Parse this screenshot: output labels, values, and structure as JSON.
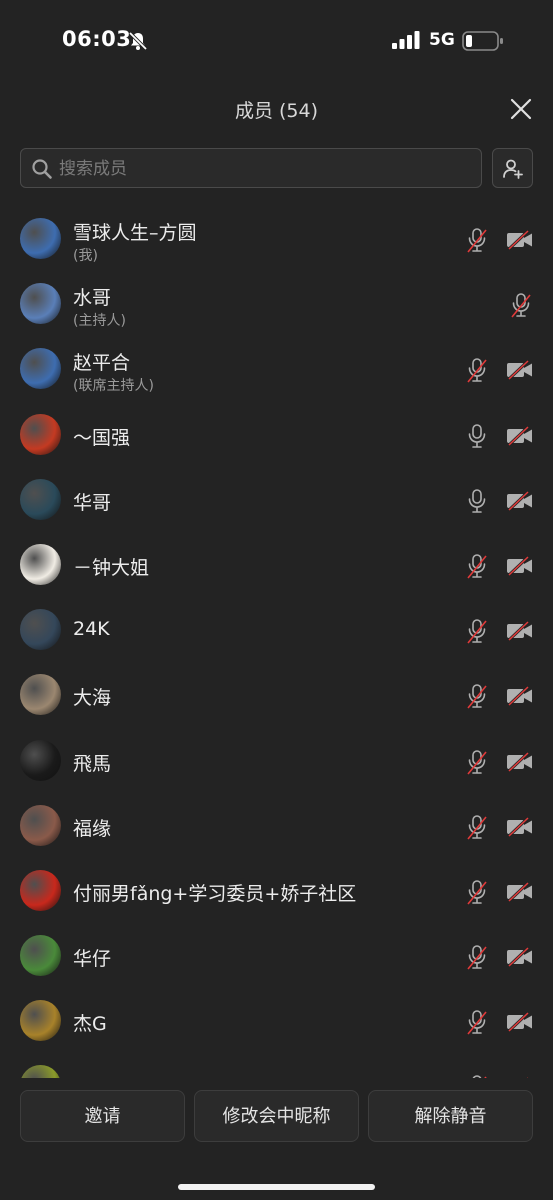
{
  "status_bar": {
    "time": "06:03",
    "network": "5G"
  },
  "header": {
    "title": "成员 (54)"
  },
  "search": {
    "placeholder": "搜索成员"
  },
  "members": [
    {
      "name": "雪球人生–方圆",
      "role": "(我)",
      "mic_muted": true,
      "video_off": true,
      "avatar_color": "#3e6db0"
    },
    {
      "name": "水哥",
      "role": "(主持人)",
      "mic_muted": true,
      "video_off": null,
      "avatar_color": "#5a7fb8"
    },
    {
      "name": "赵平合",
      "role": "(联席主持人)",
      "mic_muted": true,
      "video_off": true,
      "avatar_color": "#3e6db0"
    },
    {
      "name": "～国强",
      "role": "",
      "mic_muted": false,
      "video_off": true,
      "avatar_color": "#c43a22"
    },
    {
      "name": "华哥",
      "role": "",
      "mic_muted": false,
      "video_off": true,
      "avatar_color": "#2a4a5a"
    },
    {
      "name": "－钟大姐",
      "role": "",
      "mic_muted": true,
      "video_off": true,
      "avatar_color": "#f0ece4"
    },
    {
      "name": "24K",
      "role": "",
      "mic_muted": true,
      "video_off": true,
      "avatar_color": "#34475a"
    },
    {
      "name": "大海",
      "role": "",
      "mic_muted": true,
      "video_off": true,
      "avatar_color": "#9b8770"
    },
    {
      "name": "飛馬",
      "role": "",
      "mic_muted": true,
      "video_off": true,
      "avatar_color": "#1a1a1a"
    },
    {
      "name": "福缘",
      "role": "",
      "mic_muted": true,
      "video_off": true,
      "avatar_color": "#8a5a4a"
    },
    {
      "name": "付丽男fǎng+学习委员+娇子社区",
      "role": "",
      "mic_muted": true,
      "video_off": true,
      "avatar_color": "#c8281c"
    },
    {
      "name": "华仔",
      "role": "",
      "mic_muted": true,
      "video_off": true,
      "avatar_color": "#4a8a3a"
    },
    {
      "name": "杰G",
      "role": "",
      "mic_muted": true,
      "video_off": true,
      "avatar_color": "#a8822a"
    },
    {
      "name": "",
      "role": "",
      "mic_muted": true,
      "video_off": true,
      "avatar_color": "#8a9a2a"
    }
  ],
  "footer": {
    "invite": "邀请",
    "rename": "修改会中昵称",
    "unmute": "解除静音"
  },
  "colors": {
    "muted_slash": "#e03a3a",
    "icon_gray": "#b0b0b0",
    "background": "#232323"
  }
}
